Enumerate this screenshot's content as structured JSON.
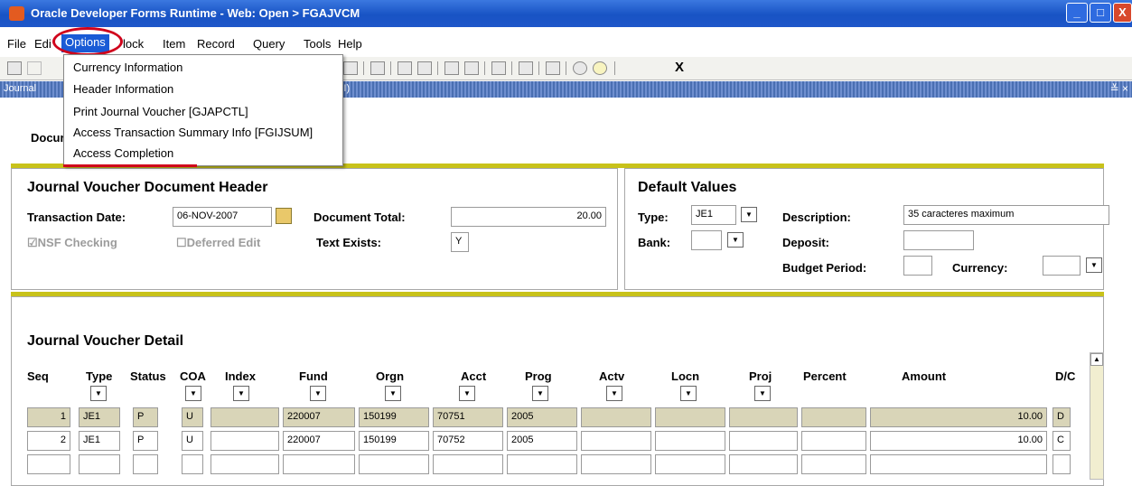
{
  "window": {
    "title": "Oracle Developer Forms Runtime - Web:  Open > FGAJVCM",
    "btn_min": "_",
    "btn_max": "□",
    "btn_close": "X"
  },
  "menubar": [
    "File",
    "Edit",
    "Options",
    "Block",
    "Item",
    "Record",
    "Query",
    "Tools",
    "Help"
  ],
  "menu_shown": [
    "File",
    "Edi",
    "Options",
    "lock",
    "Item",
    "Record",
    "Query",
    "Tools",
    "Help"
  ],
  "toolbar": {
    "exit": "X"
  },
  "form": {
    "title_left": "Journal",
    "title_right": "(FI)",
    "close": "≚ ×"
  },
  "options_menu": [
    "Currency Information",
    "Header Information",
    "Print Journal Voucher [GJAPCTL]",
    "Access Transaction Summary Info [FGIJSUM]",
    "Access Completion"
  ],
  "doc_label": "Docur",
  "header": {
    "title": "Journal Voucher Document Header",
    "trans_date_label": "Transaction Date:",
    "trans_date": "06-NOV-2007",
    "doc_total_label": "Document Total:",
    "doc_total": "20.00",
    "nsf": "☑NSF Checking",
    "deferred": "☐Deferred Edit",
    "text_exists_label": "Text Exists:",
    "text_exists": "Y"
  },
  "defaults": {
    "title": "Default Values",
    "type_label": "Type:",
    "type": "JE1",
    "desc_label": "Description:",
    "desc": "35 caracteres maximum",
    "bank_label": "Bank:",
    "deposit_label": "Deposit:",
    "budget_label": "Budget Period:",
    "currency_label": "Currency:"
  },
  "detail": {
    "title": "Journal Voucher Detail",
    "columns": [
      "Seq",
      "Type",
      "Status",
      "COA",
      "Index",
      "Fund",
      "Orgn",
      "Acct",
      "Prog",
      "Actv",
      "Locn",
      "Proj",
      "Percent",
      "Amount",
      "D/C"
    ],
    "rows": [
      {
        "seq": "1",
        "type": "JE1",
        "status": "P",
        "coa": "U",
        "fund": "220007",
        "orgn": "150199",
        "acct": "70751",
        "prog": "2005",
        "amount": "10.00",
        "dc": "D"
      },
      {
        "seq": "2",
        "type": "JE1",
        "status": "P",
        "coa": "U",
        "fund": "220007",
        "orgn": "150199",
        "acct": "70752",
        "prog": "2005",
        "amount": "10.00",
        "dc": "C"
      }
    ]
  }
}
